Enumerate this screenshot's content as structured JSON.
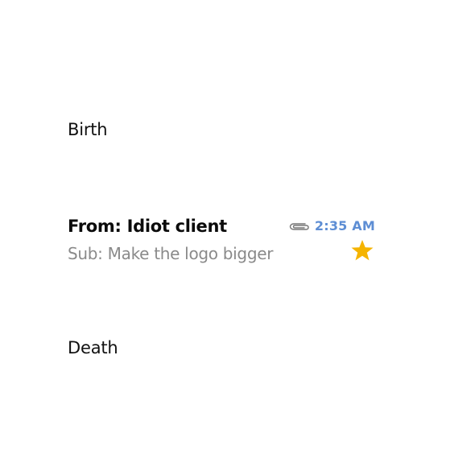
{
  "labels": {
    "top": "Birth",
    "bottom": "Death"
  },
  "email": {
    "from": "From: Idiot client",
    "subject": "Sub: Make the logo bigger",
    "time": "2:35 AM",
    "has_attachment": true,
    "starred": true
  },
  "colors": {
    "time": "#5e8ed4",
    "star": "#f5b400",
    "subject": "#8a8a8a",
    "attachment_icon": "#777777"
  },
  "icons": {
    "attachment": "paperclip-icon",
    "star": "star-icon"
  }
}
